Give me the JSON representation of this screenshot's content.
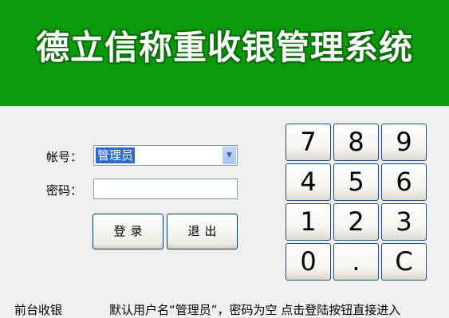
{
  "header": {
    "title": "德立信称重收银管理系统",
    "bg_color": "#0a9a0a"
  },
  "login": {
    "account_label": "帐号：",
    "account_value": "管理员",
    "password_label": "密码：",
    "password_value": "",
    "login_button": "登录",
    "exit_button": "退出"
  },
  "keypad": {
    "keys": [
      "7",
      "8",
      "9",
      "4",
      "5",
      "6",
      "1",
      "2",
      "3",
      "0",
      ".",
      "C"
    ]
  },
  "footer": {
    "left_text": "前台收银",
    "hint": "默认用户名“管理员”，密码为空  点击登陆按钮直接进入"
  }
}
